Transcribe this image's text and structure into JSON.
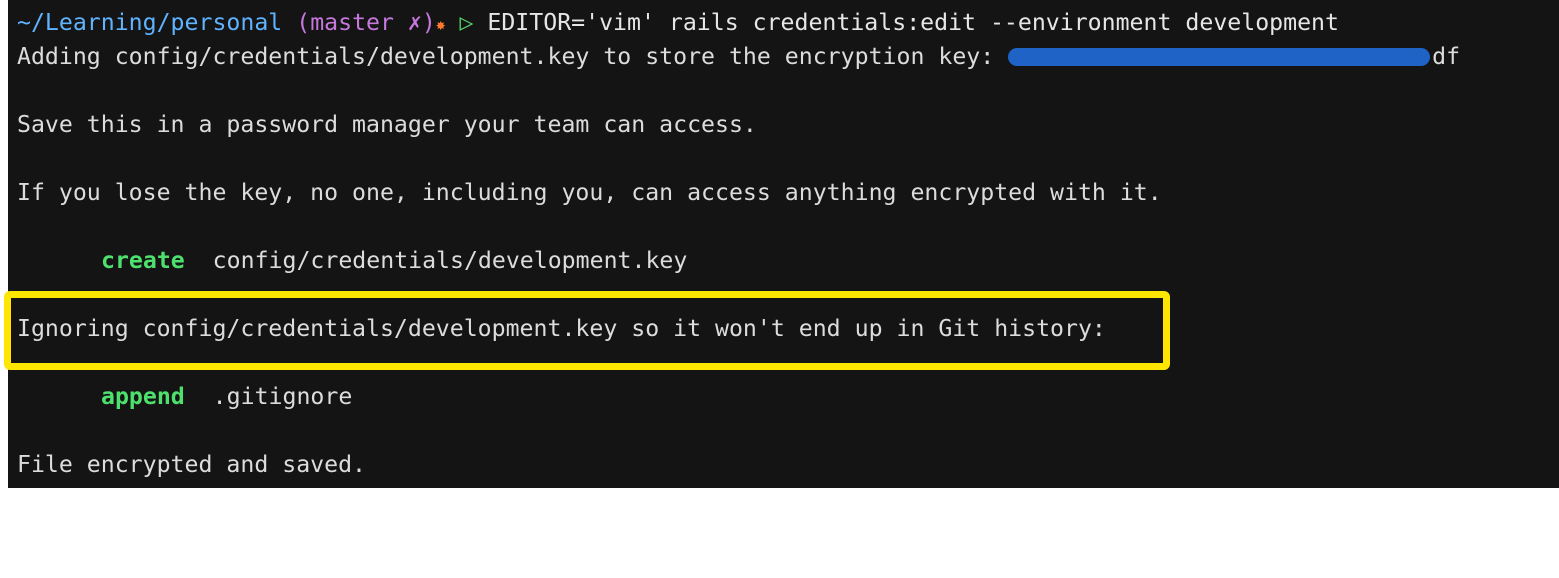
{
  "prompt": {
    "path": "~/Learning/personal",
    "branch_open": "(",
    "branch_name": "master",
    "dirty_marker": " ✗",
    "branch_close": ")",
    "star": "✸",
    "arrow": "▷",
    "command": "EDITOR='vim' rails credentials:edit --environment development"
  },
  "output": {
    "adding_text": "Adding config/credentials/development.key to store the encryption key: ",
    "key_suffix": "df",
    "save_notice": "Save this in a password manager your team can access.",
    "lose_warning": "If you lose the key, no one, including you, can access anything encrypted with it.",
    "create_action": "create",
    "create_target": "  config/credentials/development.key",
    "ignoring_text": "Ignoring config/credentials/development.key so it won't end up in Git history:",
    "append_action": "append",
    "append_target": "  .gitignore",
    "final_status": "File encrypted and saved."
  },
  "colors": {
    "terminal_background": "#141414",
    "path": "#5fb3ff",
    "branch": "#c678dd",
    "action": "#4ee06d",
    "highlight": "#ffe600",
    "redaction": "#1f63c7"
  }
}
